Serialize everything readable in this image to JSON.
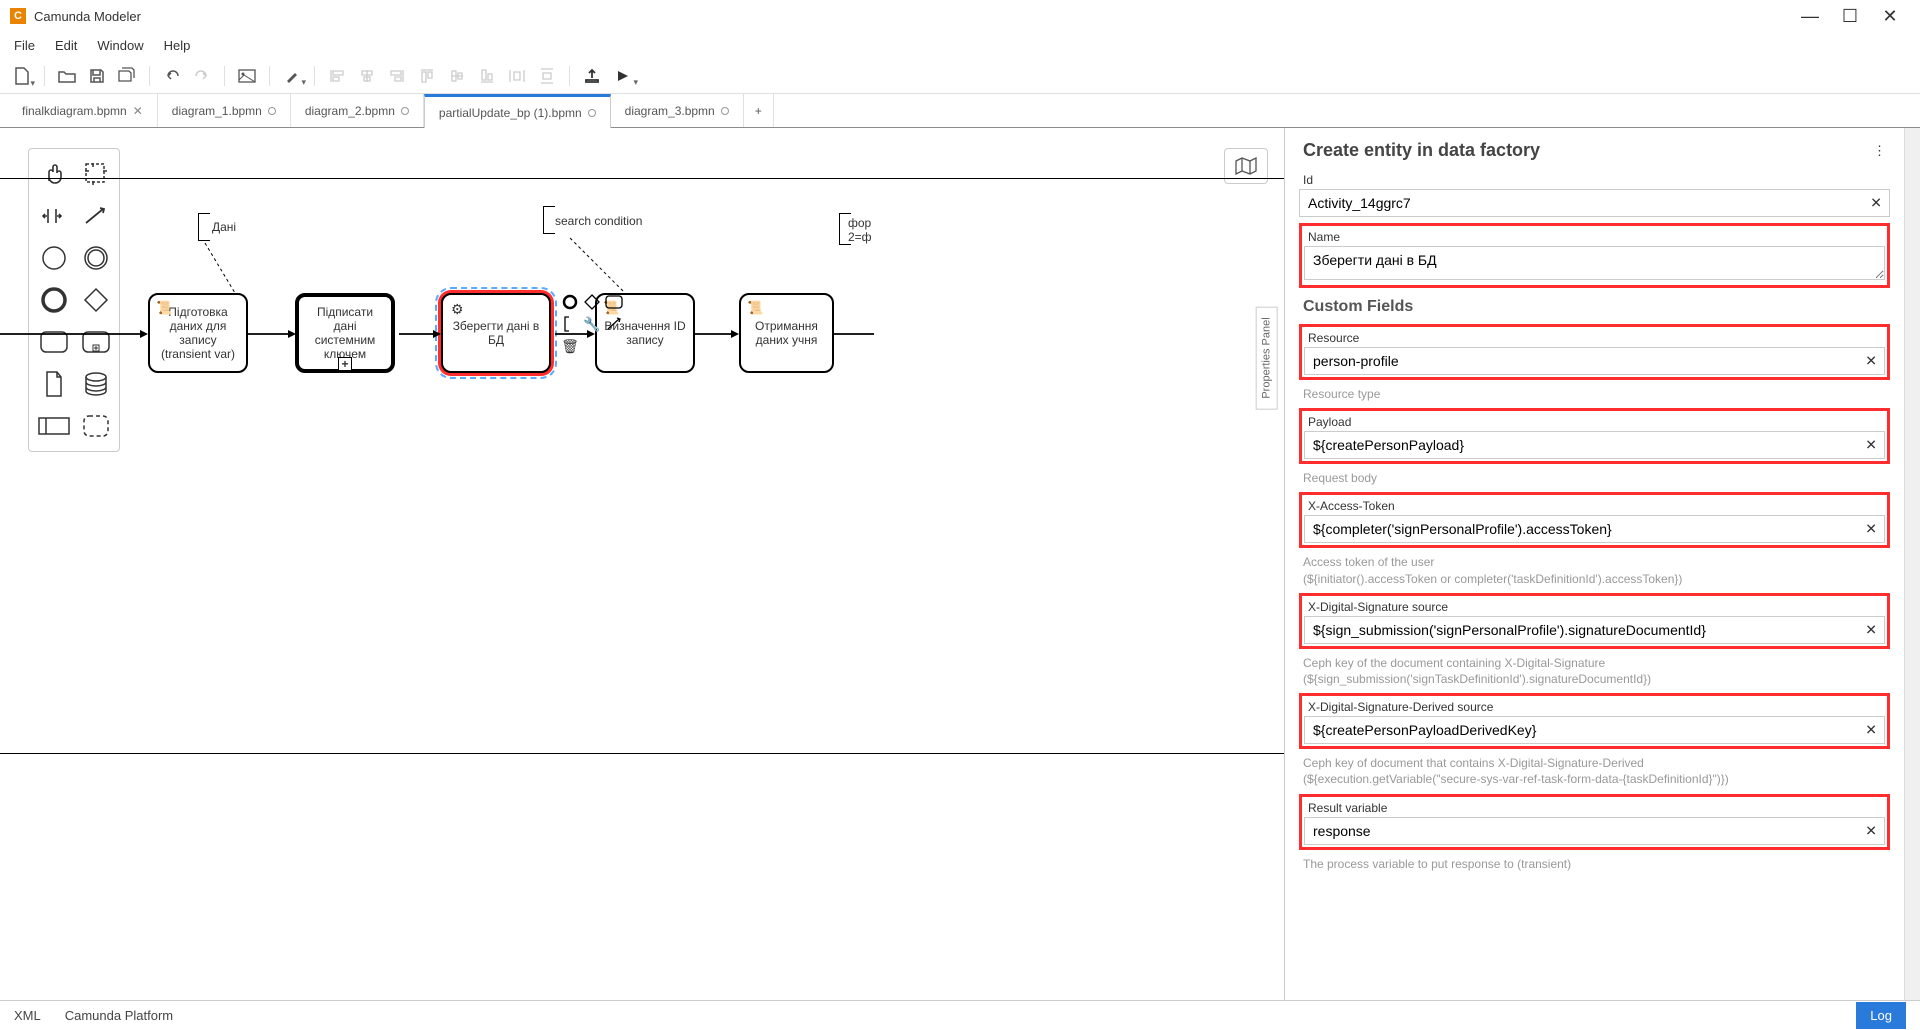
{
  "app": {
    "title": "Camunda Modeler"
  },
  "menu": [
    "File",
    "Edit",
    "Window",
    "Help"
  ],
  "tabs": [
    {
      "label": "finalkdiagram.bpmn",
      "active": false,
      "close": "x"
    },
    {
      "label": "diagram_1.bpmn",
      "active": false,
      "close": "o"
    },
    {
      "label": "diagram_2.bpmn",
      "active": false,
      "close": "o"
    },
    {
      "label": "partialUpdate_bp (1).bpmn",
      "active": true,
      "close": "o"
    },
    {
      "label": "diagram_3.bpmn",
      "active": false,
      "close": "o"
    }
  ],
  "canvas": {
    "annotations": {
      "data": "Дані",
      "search": "search condition",
      "form": "фор\n2=ф"
    },
    "nodes": {
      "prep": "Підготовка даних для запису (transient var)",
      "sign": "Підписати дані системним ключем",
      "save": "Зберегти дані в БД",
      "getid": "Визначення ID запису",
      "getstudent": "Отримання даних учня"
    },
    "props_toggle": "Properties Panel"
  },
  "properties": {
    "title": "Create entity in data factory",
    "id_label": "Id",
    "id_value": "Activity_14ggrc7",
    "name_label": "Name",
    "name_value": "Зберегти дані в БД",
    "custom_fields_title": "Custom Fields",
    "resource_label": "Resource",
    "resource_value": "person-profile",
    "resource_help": "Resource type",
    "payload_label": "Payload",
    "payload_value": "${createPersonPayload}",
    "payload_help": "Request body",
    "xat_label": "X-Access-Token",
    "xat_value": "${completer('signPersonalProfile').accessToken}",
    "xat_help": "Access token of the user\n(${initiator().accessToken or completer('taskDefinitionId').accessToken})",
    "xds_label": "X-Digital-Signature source",
    "xds_value": "${sign_submission('signPersonalProfile').signatureDocumentId}",
    "xds_help": "Ceph key of the document containing X-Digital-Signature\n(${sign_submission('signTaskDefinitionId').signatureDocumentId})",
    "xdsd_label": "X-Digital-Signature-Derived source",
    "xdsd_value": "${createPersonPayloadDerivedKey}",
    "xdsd_help": "Ceph key of document that contains X-Digital-Signature-Derived\n(${execution.getVariable(\"secure-sys-var-ref-task-form-data-{taskDefinitionId}\")})",
    "result_label": "Result variable",
    "result_value": "response",
    "result_help": "The process variable to put response to (transient)"
  },
  "statusbar": {
    "xml": "XML",
    "platform": "Camunda Platform",
    "log": "Log"
  }
}
